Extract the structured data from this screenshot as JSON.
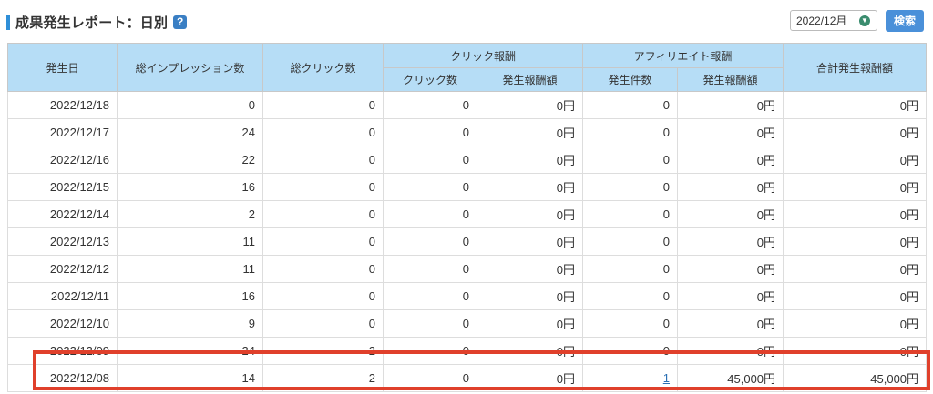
{
  "header": {
    "title": "成果発生レポート：日別",
    "help_icon": "question-mark-icon",
    "month_select": {
      "value": "2022/12月"
    },
    "search_label": "検索"
  },
  "table": {
    "headers": {
      "date": "発生日",
      "impressions": "総インプレッション数",
      "clicks": "総クリック数",
      "click_reward_group": "クリック報酬",
      "click_count": "クリック数",
      "click_reward_amount": "発生報酬額",
      "affiliate_group": "アフィリエイト報酬",
      "affiliate_count": "発生件数",
      "affiliate_amount": "発生報酬額",
      "total": "合計発生報酬額"
    },
    "rows": [
      {
        "date": "2022/12/18",
        "impressions": "0",
        "clicks": "0",
        "click_count": "0",
        "click_amount": "0円",
        "aff_count": "0",
        "aff_amount": "0円",
        "total": "0円"
      },
      {
        "date": "2022/12/17",
        "impressions": "24",
        "clicks": "0",
        "click_count": "0",
        "click_amount": "0円",
        "aff_count": "0",
        "aff_amount": "0円",
        "total": "0円"
      },
      {
        "date": "2022/12/16",
        "impressions": "22",
        "clicks": "0",
        "click_count": "0",
        "click_amount": "0円",
        "aff_count": "0",
        "aff_amount": "0円",
        "total": "0円"
      },
      {
        "date": "2022/12/15",
        "impressions": "16",
        "clicks": "0",
        "click_count": "0",
        "click_amount": "0円",
        "aff_count": "0",
        "aff_amount": "0円",
        "total": "0円"
      },
      {
        "date": "2022/12/14",
        "impressions": "2",
        "clicks": "0",
        "click_count": "0",
        "click_amount": "0円",
        "aff_count": "0",
        "aff_amount": "0円",
        "total": "0円"
      },
      {
        "date": "2022/12/13",
        "impressions": "11",
        "clicks": "0",
        "click_count": "0",
        "click_amount": "0円",
        "aff_count": "0",
        "aff_amount": "0円",
        "total": "0円"
      },
      {
        "date": "2022/12/12",
        "impressions": "11",
        "clicks": "0",
        "click_count": "0",
        "click_amount": "0円",
        "aff_count": "0",
        "aff_amount": "0円",
        "total": "0円"
      },
      {
        "date": "2022/12/11",
        "impressions": "16",
        "clicks": "0",
        "click_count": "0",
        "click_amount": "0円",
        "aff_count": "0",
        "aff_amount": "0円",
        "total": "0円"
      },
      {
        "date": "2022/12/10",
        "impressions": "9",
        "clicks": "0",
        "click_count": "0",
        "click_amount": "0円",
        "aff_count": "0",
        "aff_amount": "0円",
        "total": "0円"
      },
      {
        "date": "2022/12/09",
        "impressions": "24",
        "clicks": "2",
        "click_count": "0",
        "click_amount": "0円",
        "aff_count": "0",
        "aff_amount": "0円",
        "total": "0円"
      },
      {
        "date": "2022/12/08",
        "impressions": "14",
        "clicks": "2",
        "click_count": "0",
        "click_amount": "0円",
        "aff_count": "1",
        "aff_amount": "45,000円",
        "total": "45,000円"
      }
    ]
  },
  "colors": {
    "header_bg": "#b6ddf6",
    "highlight": "#e0402b",
    "accent": "#4a90d9"
  }
}
